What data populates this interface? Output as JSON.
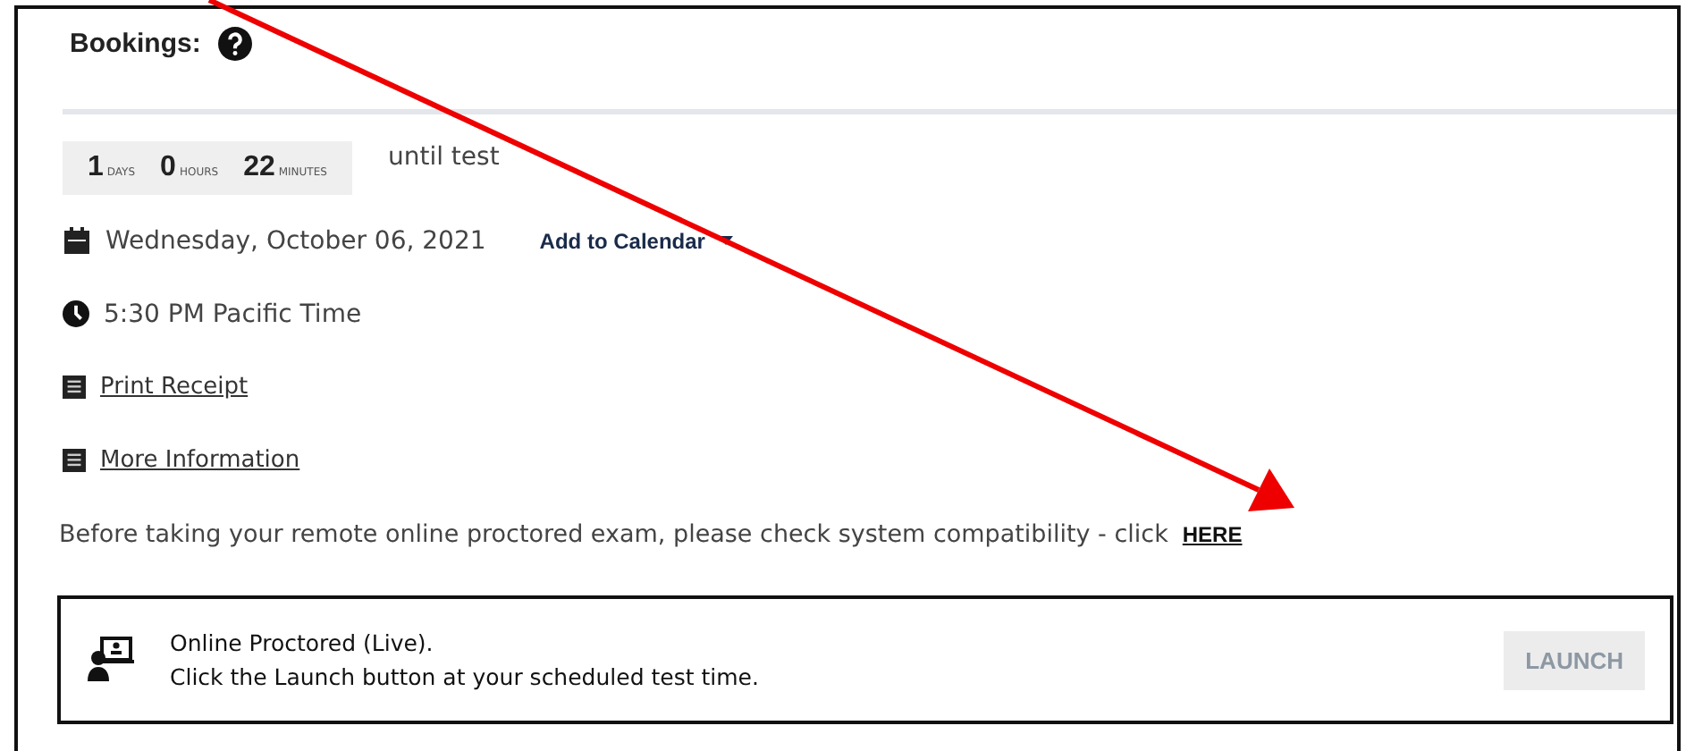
{
  "header": {
    "title": "Bookings:"
  },
  "countdown": [
    {
      "value": "1",
      "unit": "DAYS"
    },
    {
      "value": "0",
      "unit": "HOURS"
    },
    {
      "value": "22",
      "unit": "MINUTES"
    }
  ],
  "countdown_suffix": "until test",
  "date": {
    "text": "Wednesday, October 06, 2021",
    "calendar_link": "Add to Calendar"
  },
  "time": {
    "text": "5:30 PM  Pacific Time"
  },
  "links": [
    {
      "label": "Print Receipt"
    },
    {
      "label": "More Information"
    }
  ],
  "compatibility": {
    "text": "Before taking your remote online proctored exam, please check system compatibility - click",
    "link": "HERE"
  },
  "exam": {
    "title": "Online Proctored (Live).",
    "subtitle": "Click the Launch button at your scheduled test time.",
    "button": {
      "label": "LAUNCH",
      "disabled": true
    }
  }
}
